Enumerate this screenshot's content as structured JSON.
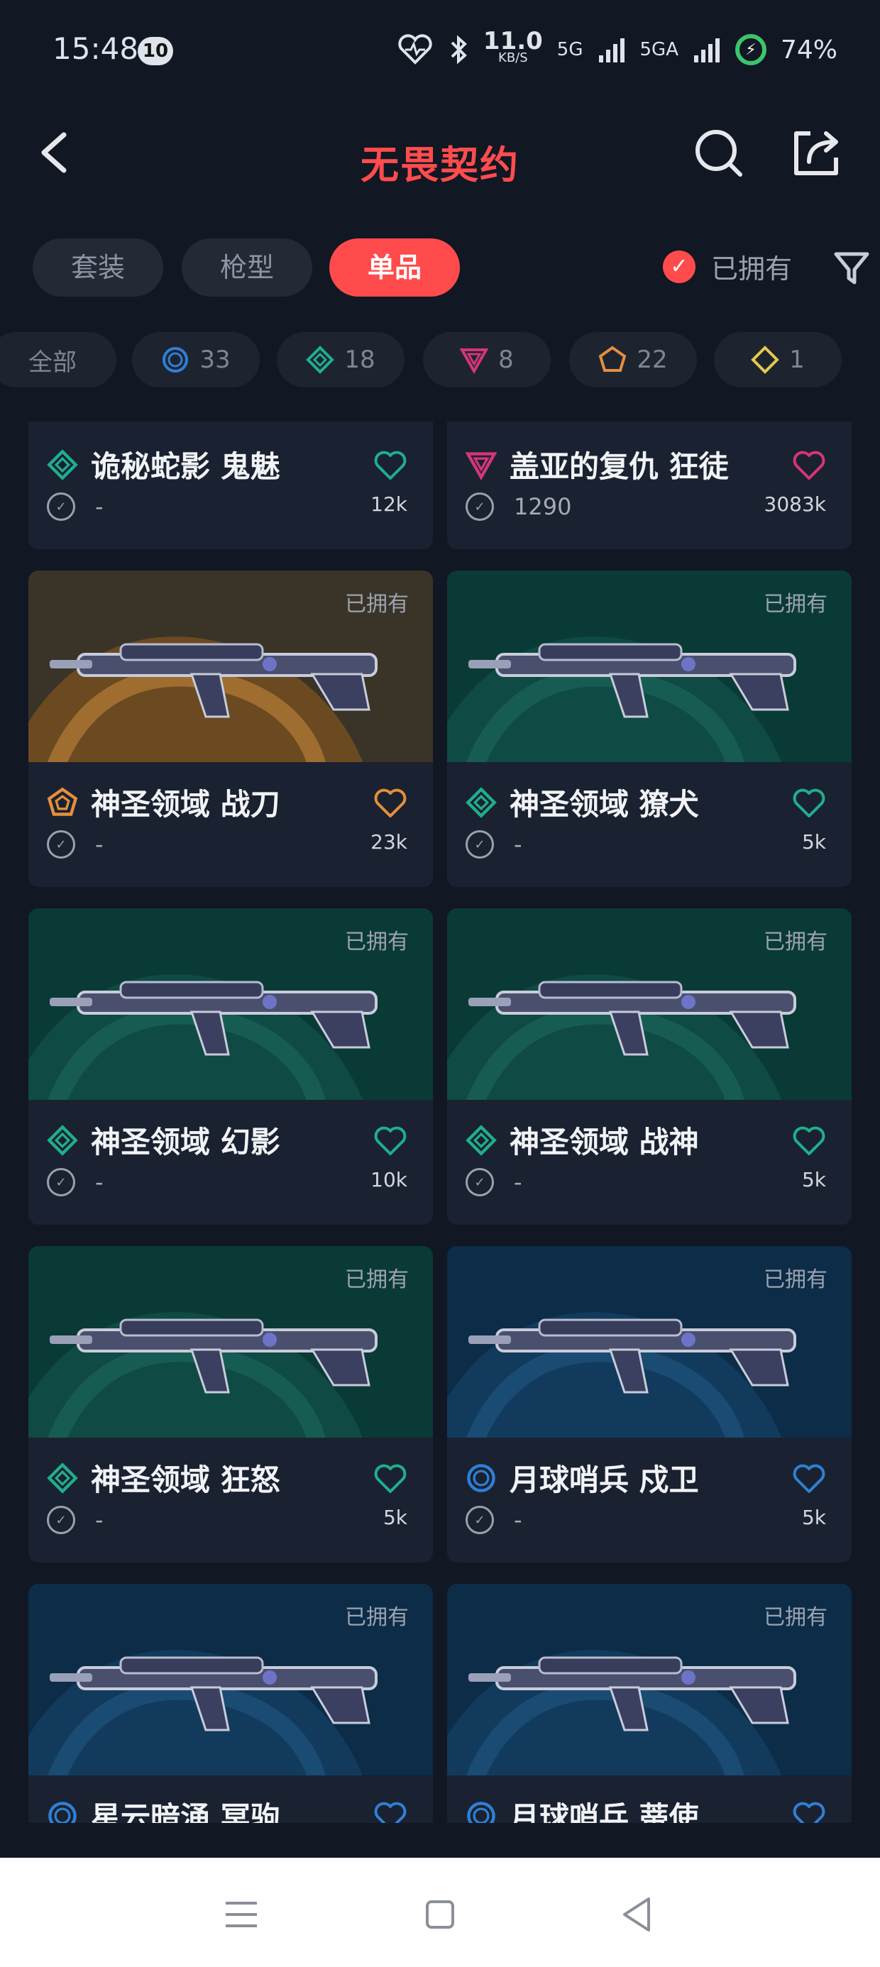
{
  "status_bar": {
    "time": "15:48",
    "notification_count": "10",
    "speed_value": "11.0",
    "speed_unit": "KB/S",
    "signal_1": "5G",
    "signal_2": "5GA",
    "battery": "74%"
  },
  "app_bar": {
    "title": "无畏契约"
  },
  "tabs": [
    {
      "label": "套装"
    },
    {
      "label": "枪型"
    },
    {
      "label": "单品",
      "active": true
    }
  ],
  "owned_filter": {
    "label": "已拥有",
    "checked": true
  },
  "tier_chips": [
    {
      "label": "全部",
      "icon": null
    },
    {
      "label": "33",
      "icon": "select-tier-circle",
      "color": "#2f7fd6"
    },
    {
      "label": "18",
      "icon": "deluxe-tier-diamond",
      "color": "#1fae8f"
    },
    {
      "label": "8",
      "icon": "premium-tier-triangle",
      "color": "#d4357a"
    },
    {
      "label": "22",
      "icon": "exclusive-tier-pentagon",
      "color": "#e48f3c"
    },
    {
      "label": "1",
      "icon": "ultra-tier-diamond",
      "color": "#e7c94a"
    }
  ],
  "cards": [
    {
      "name": "诡秘蛇影 鬼魅",
      "price": "-",
      "likes": "12k",
      "tier_color": "#1fae8f",
      "tier": "deluxe",
      "owned": "",
      "bg": "none"
    },
    {
      "name": "盖亚的复仇 狂徒",
      "price": "1290",
      "likes": "3083k",
      "tier_color": "#d4357a",
      "tier": "premium",
      "owned": "",
      "bg": "none"
    },
    {
      "name": "神圣领域 战刀",
      "price": "-",
      "likes": "23k",
      "tier_color": "#e48f3c",
      "tier": "exclusive",
      "owned": "已拥有",
      "bg": "orange"
    },
    {
      "name": "神圣领域 獠犬",
      "price": "-",
      "likes": "5k",
      "tier_color": "#1fae8f",
      "tier": "deluxe",
      "owned": "已拥有",
      "bg": "teal"
    },
    {
      "name": "神圣领域 幻影",
      "price": "-",
      "likes": "10k",
      "tier_color": "#1fae8f",
      "tier": "deluxe",
      "owned": "已拥有",
      "bg": "teal"
    },
    {
      "name": "神圣领域 战神",
      "price": "-",
      "likes": "5k",
      "tier_color": "#1fae8f",
      "tier": "deluxe",
      "owned": "已拥有",
      "bg": "teal"
    },
    {
      "name": "神圣领域 狂怒",
      "price": "-",
      "likes": "5k",
      "tier_color": "#1fae8f",
      "tier": "deluxe",
      "owned": "已拥有",
      "bg": "teal"
    },
    {
      "name": "月球哨兵 戍卫",
      "price": "-",
      "likes": "5k",
      "tier_color": "#2f7fd6",
      "tier": "select",
      "owned": "已拥有",
      "bg": "blue"
    },
    {
      "name": "星云暗涌 冥驹",
      "price": "",
      "likes": "",
      "tier_color": "#2f7fd6",
      "tier": "select",
      "owned": "已拥有",
      "bg": "blue"
    },
    {
      "name": "月球哨兵 蒂使",
      "price": "",
      "likes": "",
      "tier_color": "#2f7fd6",
      "tier": "select",
      "owned": "已拥有",
      "bg": "blue"
    }
  ],
  "nav": {
    "items": [
      {
        "icon": "menu-icon"
      },
      {
        "icon": "home-square-icon"
      },
      {
        "icon": "back-triangle-icon"
      }
    ]
  }
}
